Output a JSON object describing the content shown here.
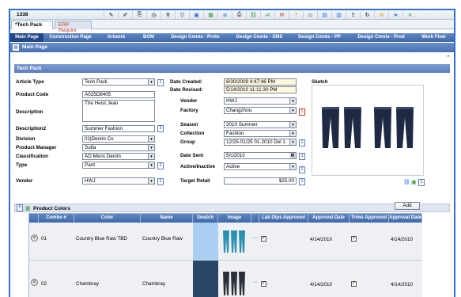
{
  "window": {
    "record_id": "1338"
  },
  "toolbar_icons": [
    "pencil-icon",
    "edit-icon",
    "copy-icon",
    "clock-icon",
    "filter-icon",
    "funnel-icon",
    "image-icon",
    "table-icon",
    "list-icon",
    "print-icon",
    "link-icon",
    "share-icon",
    "email-icon",
    "help-icon",
    "user-icon",
    "save-icon",
    "save-as-icon",
    "export-icon",
    "refresh-icon",
    "mail-icon",
    "send-icon",
    "close-icon"
  ],
  "doc_tabs": {
    "active": "*Tech Pack",
    "inactive": "ERP Require"
  },
  "module_tabs": [
    "Main Page",
    "Construction Page",
    "Artwork",
    "BOM",
    "Design Cmnts - Proto",
    "Design Cmnts - SMS",
    "Design Cmnts - PP",
    "Design Cmnts - Prod",
    "Work Flow"
  ],
  "subbar": {
    "label": "Main Page"
  },
  "section_title": "Tech Pack",
  "form": {
    "article_type": {
      "label": "Article Type",
      "value": "Tech Pack",
      "badge": "1"
    },
    "product_code": {
      "label": "Product Code",
      "value": "A025D8405"
    },
    "description": {
      "label": "Description",
      "value": "The Heist Jean"
    },
    "description2": {
      "label": "Description2",
      "value": "Summer Fashion",
      "badge": "3"
    },
    "division": {
      "label": "Division",
      "value": "01|Denim Co"
    },
    "product_manager": {
      "label": "Product Manager",
      "value": "Sufia"
    },
    "classification": {
      "label": "Classification",
      "value": "AD Mens Denim"
    },
    "type": {
      "label": "Type",
      "value": "Pant",
      "badge": "2"
    },
    "vendor_left": {
      "label": "Vendor",
      "value": "HWJ",
      "badge": "1"
    },
    "date_created": {
      "label": "Date Created:",
      "value": "6/30/2009 4:47:46 PM"
    },
    "date_revised": {
      "label": "Date Revised:",
      "value": "5/14/2010 11:11:30 PM"
    },
    "vendor": {
      "label": "Vendor",
      "value": "HWJ"
    },
    "factory": {
      "label": "Factory",
      "value": "Changzhou",
      "badge": "1"
    },
    "season": {
      "label": "Season",
      "value": "2010 Summer"
    },
    "collection": {
      "label": "Collection",
      "value": "Fashion"
    },
    "group": {
      "label": "Group",
      "value": "12/25-01/25 01-2010 Del 1",
      "badge": "1"
    },
    "date_sent": {
      "label": "Date Sent",
      "value": "5/U2010",
      "badge": "1"
    },
    "active": {
      "label": "Active/Inactive",
      "value": "Active",
      "badge": "2"
    },
    "target_retail": {
      "label": "Target Retail",
      "value": "$25.00",
      "badge": "1"
    },
    "sketch_label": "Sketch",
    "sketch_badge": "1"
  },
  "colors_panel": {
    "count_badge": "5",
    "title": "Product Colors",
    "add_label": "Add",
    "columns": [
      "Combo #",
      "Color",
      "Name",
      "Swatch",
      "Image",
      "Lab Dips Approved",
      "Approval Date",
      "Trims Approved",
      "Approval Date"
    ],
    "rows": [
      {
        "combo": "01",
        "color": "Country Blue Raw TBD",
        "name": "Country Blue Raw",
        "swatch": "#a9cff2",
        "lab_dips": true,
        "approval_date": "4/14/2010",
        "trims": true,
        "trims_date": "4/14/2010"
      },
      {
        "combo": "02",
        "color": "Chambray",
        "name": "Chambray",
        "swatch": "#2a4568",
        "lab_dips": true,
        "approval_date": "4/14/2010",
        "trims": true,
        "trims_date": "4/14/2010"
      }
    ]
  }
}
